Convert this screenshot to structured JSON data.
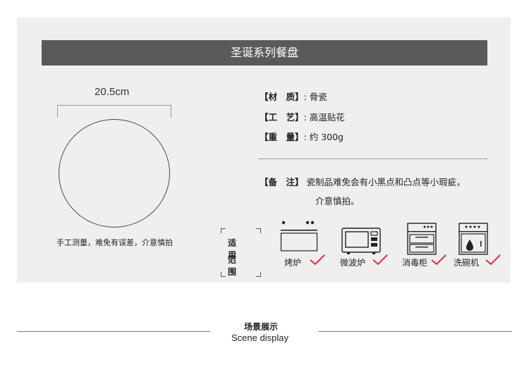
{
  "title": "圣诞系列餐盘",
  "dimension": "20.5cm",
  "measure_note": "手工测量，难免有误差，介意慎拍",
  "specs": [
    {
      "key": "【材　质】",
      "sep": ":",
      "value": "骨瓷"
    },
    {
      "key": "【工　艺】",
      "sep": ":",
      "value": "高温贴花"
    },
    {
      "key": "【重　量】",
      "sep": ":",
      "value": "约 300g"
    }
  ],
  "remark": {
    "key": "【备　注】",
    "line1": "瓷制品难免会有小黑点和凸点等小瑕疵，",
    "line2": "介意慎拍。"
  },
  "suitable": {
    "line1": "适用",
    "line2": "范围"
  },
  "appliances": [
    {
      "label": "烤炉",
      "icon": "oven-icon"
    },
    {
      "label": "微波炉",
      "icon": "microwave-icon"
    },
    {
      "label": "消毒柜",
      "icon": "sterilizer-icon"
    },
    {
      "label": "洗碗机",
      "icon": "dishwasher-icon"
    }
  ],
  "check_color": "#e0303a",
  "scene": {
    "cn": "场景展示",
    "en": "Scene display"
  }
}
